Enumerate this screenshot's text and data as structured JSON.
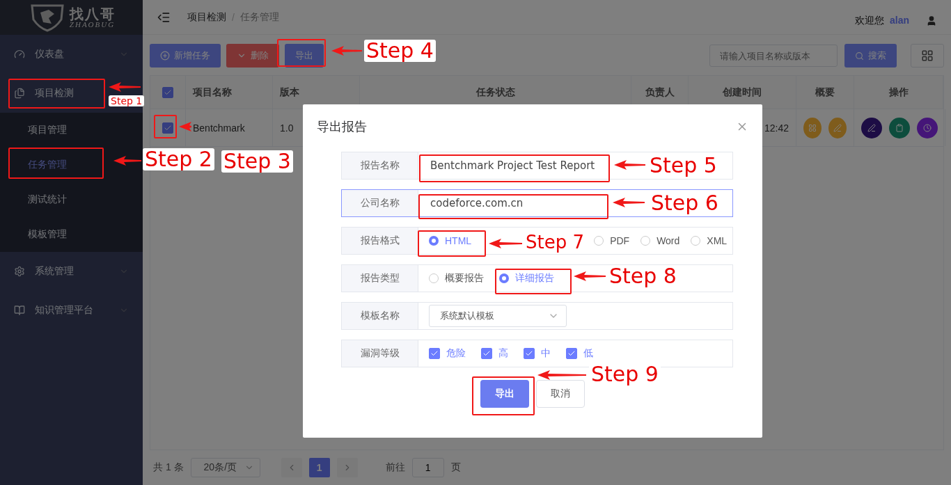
{
  "logo": {
    "name": "找八哥",
    "sub": "ZHAOBUG"
  },
  "sidebar": {
    "items": [
      {
        "label": "仪表盘",
        "kind": "dashboard",
        "expanded": false
      },
      {
        "label": "项目检测",
        "kind": "project",
        "expanded": true,
        "children": [
          {
            "label": "项目管理",
            "selected": false
          },
          {
            "label": "任务管理",
            "selected": true
          },
          {
            "label": "测试统计",
            "selected": false
          },
          {
            "label": "模板管理",
            "selected": false
          }
        ]
      },
      {
        "label": "系统管理",
        "kind": "settings",
        "expanded": false
      },
      {
        "label": "知识管理平台",
        "kind": "book",
        "expanded": false
      }
    ]
  },
  "breadcrumb": [
    "项目检测",
    "任务管理"
  ],
  "breadcrumb_separator": "/",
  "user": {
    "greeting": "欢迎您",
    "name": "alan"
  },
  "toolbar": {
    "buttons": [
      {
        "label": "新增任务",
        "kind": "add"
      },
      {
        "label": "删除",
        "kind": "delete"
      },
      {
        "label": "导出",
        "kind": "export"
      }
    ],
    "search": {
      "placeholder": "请输入项目名称或版本"
    },
    "search_button": "搜索"
  },
  "table": {
    "header_checked": true,
    "columns": [
      "项目名称",
      "版本",
      "任务状态",
      "负责人",
      "创建时间",
      "概要",
      "操作"
    ],
    "rows": [
      {
        "checked": true,
        "name": "Bentchmark",
        "version": "1.0",
        "created": "12:42"
      }
    ]
  },
  "pagination": {
    "total": "共 1 条",
    "page_size": "20条/页",
    "pages": [
      {
        "label": "1",
        "selected": true
      }
    ],
    "goto_label": "前往",
    "goto_value": "1",
    "page_suffix": "页"
  },
  "dialog": {
    "title": "导出报告",
    "fields": [
      {
        "kind": "text",
        "label": "报告名称",
        "value": "Bentchmark Project Test Report",
        "focused": false
      },
      {
        "kind": "text",
        "label": "公司名称",
        "value": "codeforce.com.cn",
        "focused": true
      },
      {
        "kind": "radio",
        "label": "报告格式",
        "options": [
          {
            "label": "HTML",
            "selected": true
          },
          {
            "label": "PDF",
            "selected": false
          },
          {
            "label": "Word",
            "selected": false
          },
          {
            "label": "XML",
            "selected": false
          }
        ]
      },
      {
        "kind": "radio",
        "label": "报告类型",
        "options": [
          {
            "label": "概要报告",
            "selected": false
          },
          {
            "label": "详细报告",
            "selected": true
          }
        ]
      },
      {
        "kind": "select",
        "label": "模板名称",
        "value": "系统默认模板"
      },
      {
        "kind": "checkbox",
        "label": "漏洞等级",
        "options": [
          {
            "label": "危险",
            "checked": true
          },
          {
            "label": "高",
            "checked": true
          },
          {
            "label": "中",
            "checked": true
          },
          {
            "label": "低",
            "checked": true
          }
        ]
      }
    ],
    "buttons": [
      {
        "label": "导出",
        "kind": "primary"
      },
      {
        "label": "取消",
        "kind": "default"
      }
    ]
  },
  "annotations": [
    {
      "label": "Step 1"
    },
    {
      "label": "Step 2"
    },
    {
      "label": "Step 3"
    },
    {
      "label": "Step 4"
    },
    {
      "label": "Step 5"
    },
    {
      "label": "Step 6"
    },
    {
      "label": "Step 7"
    },
    {
      "label": "Step 8"
    },
    {
      "label": "Step 9"
    }
  ]
}
